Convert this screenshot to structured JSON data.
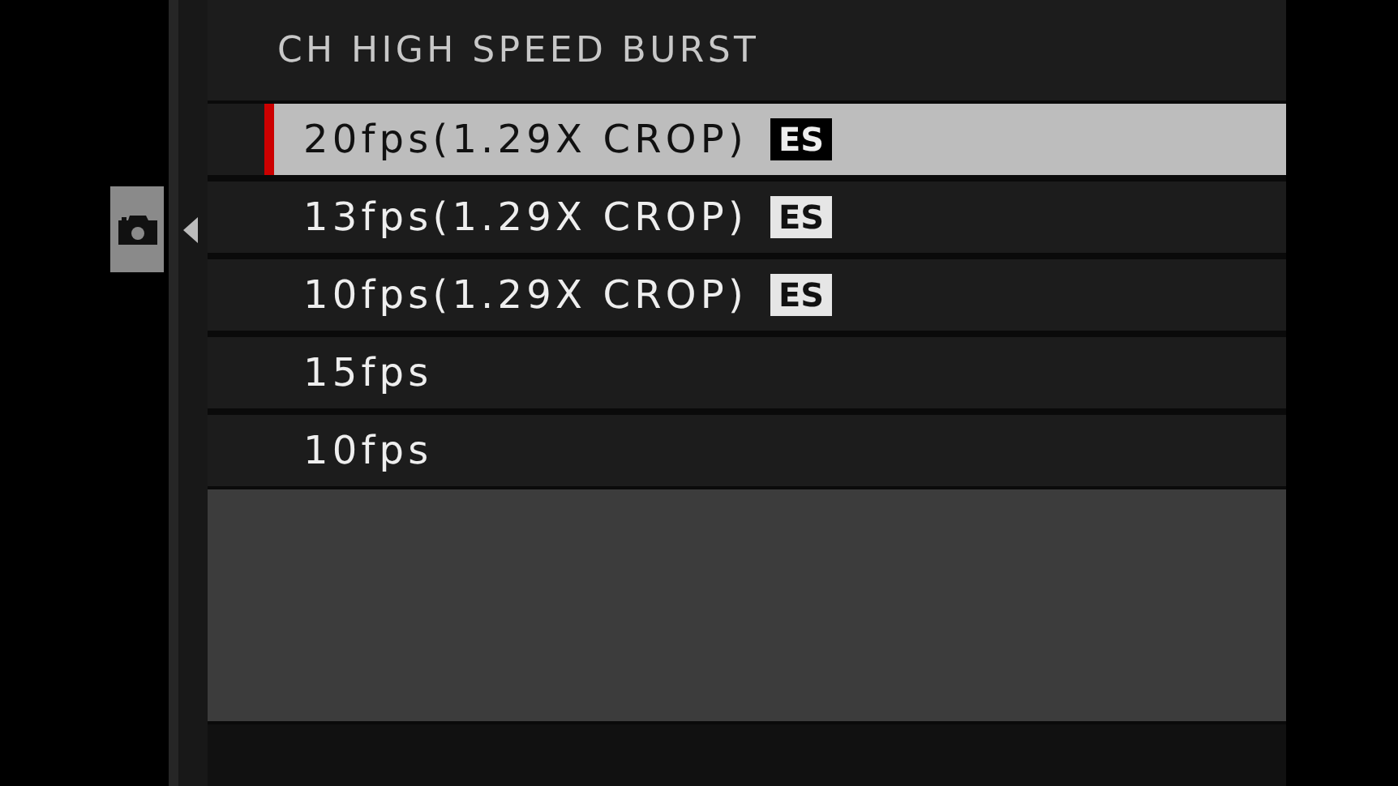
{
  "sidebar": {
    "tabs": [
      {
        "kind": "camera",
        "selected": true
      }
    ]
  },
  "menu": {
    "title": "CH HIGH SPEED BURST",
    "items": [
      {
        "label": "20fps(1.29X CROP)",
        "badge": "ES",
        "selected": true
      },
      {
        "label": "13fps(1.29X CROP)",
        "badge": "ES",
        "selected": false
      },
      {
        "label": "10fps(1.29X CROP)",
        "badge": "ES",
        "selected": false
      },
      {
        "label": "15fps",
        "selected": false
      },
      {
        "label": "10fps",
        "selected": false
      }
    ]
  }
}
